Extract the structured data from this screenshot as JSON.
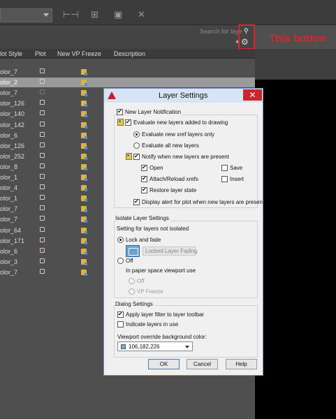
{
  "toolbar": {
    "icons": [
      "layer-combo",
      "measure-icon",
      "isolate-icon",
      "paste-icon",
      "close-icon"
    ]
  },
  "palette": {
    "search_placeholder": "Search for laye",
    "callout_text": "This button",
    "columns": [
      "lot Style",
      "Plot",
      "New VP Freeze",
      "Description"
    ]
  },
  "layers": [
    {
      "style": "olor_7",
      "plot": "on"
    },
    {
      "style": "olor_2",
      "plot": "on",
      "selected": true
    },
    {
      "style": "olor_7",
      "plot": "off"
    },
    {
      "style": "olor_126",
      "plot": "on"
    },
    {
      "style": "olor_140",
      "plot": "on"
    },
    {
      "style": "olor_142",
      "plot": "on"
    },
    {
      "style": "olor_6",
      "plot": "on"
    },
    {
      "style": "olor_126",
      "plot": "on"
    },
    {
      "style": "olor_252",
      "plot": "on"
    },
    {
      "style": "olor_8",
      "plot": "on"
    },
    {
      "style": "olor_1",
      "plot": "on"
    },
    {
      "style": "olor_4",
      "plot": "on"
    },
    {
      "style": "olor_1",
      "plot": "on"
    },
    {
      "style": "olor_7",
      "plot": "on"
    },
    {
      "style": "olor_7",
      "plot": "on"
    },
    {
      "style": "olor_64",
      "plot": "on"
    },
    {
      "style": "olor_171",
      "plot": "on"
    },
    {
      "style": "olor_6",
      "plot": "noplot"
    },
    {
      "style": "olor_3",
      "plot": "on"
    },
    {
      "style": "olor_7",
      "plot": "on"
    }
  ],
  "dialog": {
    "title": "Layer Settings",
    "close_label": "✕",
    "new_layer_group": "New Layer Notification",
    "evaluate_new": "Evaluate new layers added to drawing",
    "evaluate_xref": "Evaluate new xref layers only",
    "evaluate_all": "Evaluate all new layers",
    "notify_present": "Notify when new layers are present",
    "opt_open": "Open",
    "opt_save": "Save",
    "opt_attach": "Attach/Reload xrefs",
    "opt_insert": "Insert",
    "opt_restore": "Restore layer state",
    "display_alert": "Display alert for plot when new layers are presen",
    "isolate_group": "Isolate Layer Settings",
    "not_isolated": "Setting for layers not isolated",
    "lock_fade": "Lock and fade",
    "locked_fading": "Locked Layer Fading",
    "off": "Off",
    "paper_space": "In paper space viewport use",
    "ps_off": "Off",
    "ps_vp_freeze": "VP Freeze",
    "dialog_group": "Dialog Settings",
    "apply_filter": "Apply layer filter to layer toolbar",
    "indicate_use": "Indicate layers in use",
    "viewport_override": "Viewport override background color:",
    "color_value": "106,182,226",
    "ok": "OK",
    "cancel": "Cancel",
    "help": "Help"
  }
}
